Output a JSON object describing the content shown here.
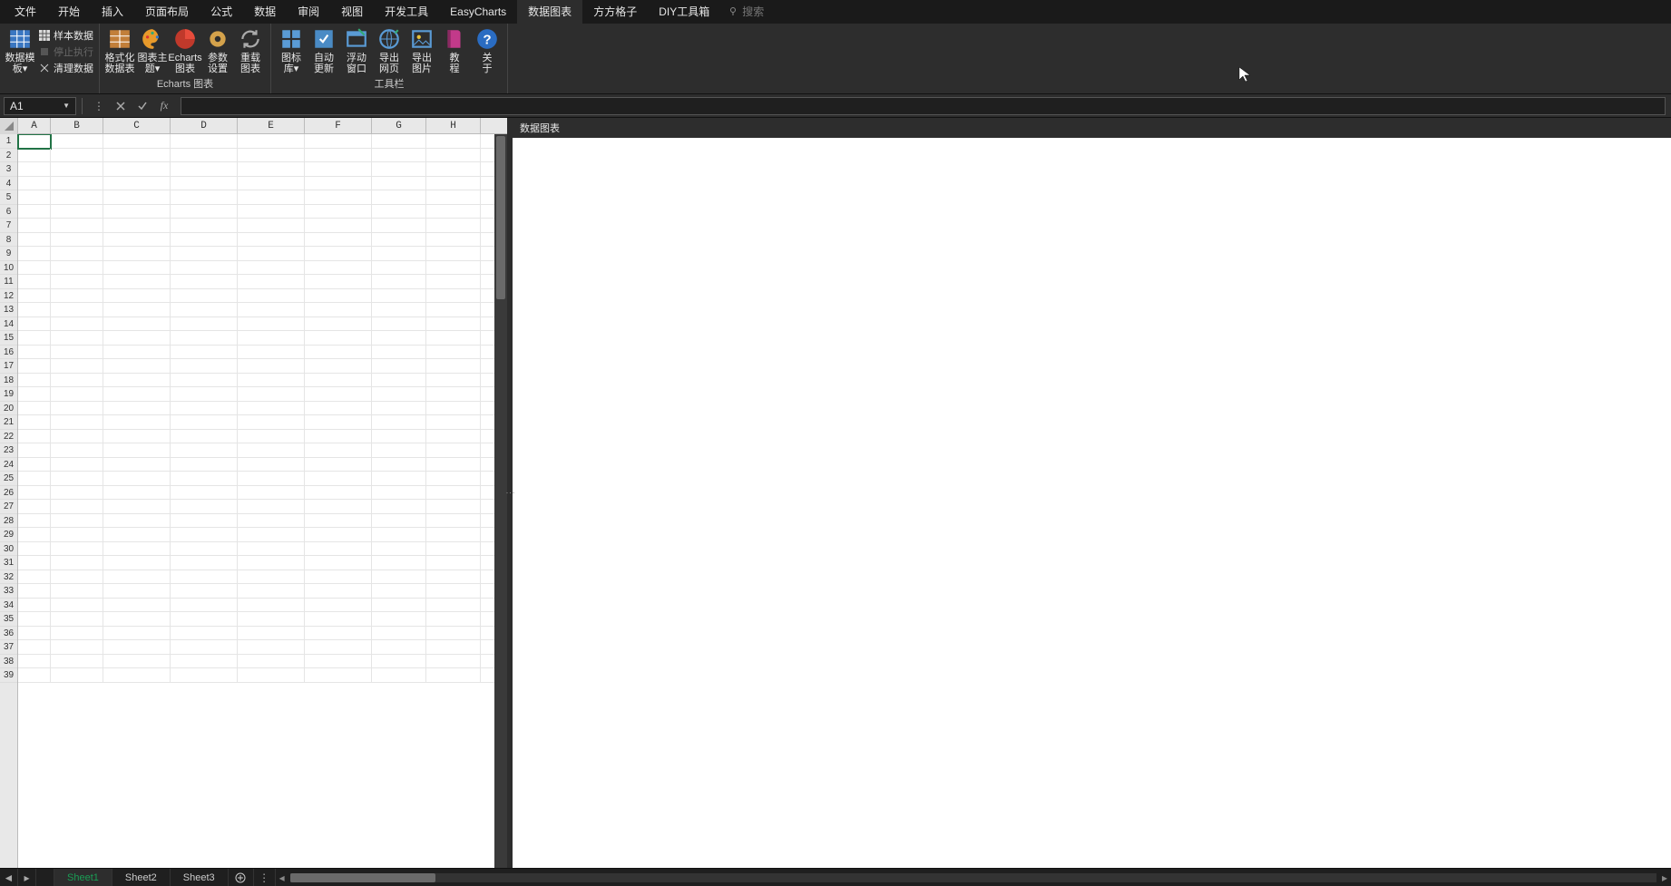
{
  "menu": {
    "items": [
      "文件",
      "开始",
      "插入",
      "页面布局",
      "公式",
      "数据",
      "审阅",
      "视图",
      "开发工具",
      "EasyCharts",
      "数据图表",
      "方方格子",
      "DIY工具箱"
    ],
    "active_index": 10,
    "search_placeholder": "搜索"
  },
  "ribbon": {
    "group1": {
      "btn_template": {
        "l1": "数据模",
        "l2": "板▾"
      },
      "sample_data": "样本数据",
      "stop_exec": "停止执行",
      "clean_data": "清理数据"
    },
    "group2": {
      "label": "Echarts 图表",
      "btn_format": {
        "l1": "格式化",
        "l2": "数据表"
      },
      "btn_theme": {
        "l1": "图表主",
        "l2": "题▾"
      },
      "btn_echarts": {
        "l1": "Echarts",
        "l2": "图表"
      },
      "btn_params": {
        "l1": "参数",
        "l2": "设置"
      },
      "btn_reload": {
        "l1": "重载",
        "l2": "图表"
      }
    },
    "group3": {
      "label": "工具栏",
      "btn_iconlib": {
        "l1": "图标",
        "l2": "库▾"
      },
      "btn_autoupdate": {
        "l1": "自动",
        "l2": "更新"
      },
      "btn_float": {
        "l1": "浮动",
        "l2": "窗口"
      },
      "btn_exportweb": {
        "l1": "导出",
        "l2": "网页"
      },
      "btn_exportimg": {
        "l1": "导出",
        "l2": "图片"
      },
      "btn_tutorial": {
        "l1": "教",
        "l2": "程"
      },
      "btn_about": {
        "l1": "关",
        "l2": "于"
      }
    }
  },
  "formula_bar": {
    "name_box": "A1",
    "fx_label": "fx",
    "formula_value": ""
  },
  "sheet": {
    "columns": [
      "A",
      "B",
      "C",
      "D",
      "E",
      "F",
      "G",
      "H"
    ],
    "row_count": 39,
    "active_cell": "A1"
  },
  "chart_panel": {
    "title": "数据图表"
  },
  "tabs": {
    "items": [
      "Sheet1",
      "Sheet2",
      "Sheet3"
    ],
    "active_index": 0
  },
  "chart_data": {
    "type": "table",
    "columns": [
      "A",
      "B",
      "C",
      "D",
      "E",
      "F",
      "G",
      "H"
    ],
    "rows": []
  }
}
